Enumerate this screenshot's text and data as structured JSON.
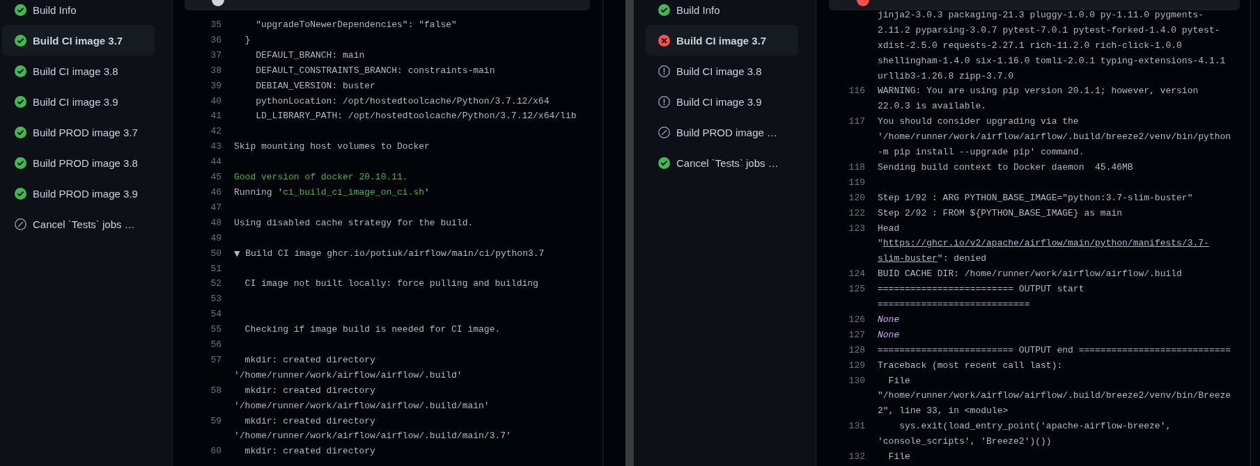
{
  "panes": [
    {
      "sidebar": {
        "items": [
          {
            "label": "Build Info",
            "kind": "success",
            "selected": false
          },
          {
            "label": "Build CI image 3.7",
            "kind": "success",
            "selected": true
          },
          {
            "label": "Build CI image 3.8",
            "kind": "success",
            "selected": false
          },
          {
            "label": "Build CI image 3.9",
            "kind": "success",
            "selected": false
          },
          {
            "label": "Build PROD image 3.7",
            "kind": "success",
            "selected": false
          },
          {
            "label": "Build PROD image 3.8",
            "kind": "success",
            "selected": false
          },
          {
            "label": "Build PROD image 3.9",
            "kind": "success",
            "selected": false
          },
          {
            "label": "Cancel `Tests` jobs …",
            "kind": "skipped",
            "selected": false
          }
        ]
      },
      "log": {
        "header": {
          "kind": "neutral"
        },
        "lines": [
          {
            "number": "35",
            "rows": [
              "    \"upgradeToNewerDependencies\": \"false\""
            ]
          },
          {
            "number": "36",
            "rows": [
              "  }"
            ]
          },
          {
            "number": "37",
            "rows": [
              "    DEFAULT_BRANCH: main"
            ]
          },
          {
            "number": "38",
            "rows": [
              "    DEFAULT_CONSTRAINTS_BRANCH: constraints-main"
            ]
          },
          {
            "number": "39",
            "rows": [
              "    DEBIAN_VERSION: buster"
            ]
          },
          {
            "number": "40",
            "rows": [
              "    pythonLocation: /opt/hostedtoolcache/Python/3.7.12/x64"
            ]
          },
          {
            "number": "41",
            "rows": [
              "    LD_LIBRARY_PATH: /opt/hostedtoolcache/Python/3.7.12/x64/lib"
            ]
          },
          {
            "number": "42"
          },
          {
            "number": "43",
            "rows": [
              "Skip mounting host volumes to Docker"
            ]
          },
          {
            "number": "44"
          },
          {
            "number": "45",
            "rows": [
              [
                {
                  "text": "Good version of docker 20.10.11.",
                  "kind": "green"
                }
              ]
            ]
          },
          {
            "number": "46",
            "rows": [
              [
                {
                  "text": "Running '"
                },
                {
                  "text": "ci_build_ci_image_on_ci.sh",
                  "kind": "green"
                },
                {
                  "text": "'"
                }
              ]
            ]
          },
          {
            "number": "47"
          },
          {
            "number": "48",
            "rows": [
              "Using disabled cache strategy for the build."
            ]
          },
          {
            "number": "49"
          },
          {
            "number": "50",
            "rows": [
              [
                {
                  "text": "▼",
                  "kind": "toggle"
                },
                {
                  "text": " Build CI image ghcr.io/potiuk/airflow/main/ci/python3.7"
                }
              ]
            ]
          },
          {
            "number": "51"
          },
          {
            "number": "52",
            "rows": [
              "  CI image not built locally: force pulling and building"
            ]
          },
          {
            "number": "53"
          },
          {
            "number": "54"
          },
          {
            "number": "55",
            "rows": [
              "  Checking if image build is needed for CI image."
            ]
          },
          {
            "number": "56"
          },
          {
            "number": "57",
            "rows": [
              "  mkdir: created directory",
              "'/home/runner/work/airflow/airflow/.build'"
            ]
          },
          {
            "number": "58",
            "rows": [
              "  mkdir: created directory",
              "'/home/runner/work/airflow/airflow/.build/main'"
            ]
          },
          {
            "number": "59",
            "rows": [
              "  mkdir: created directory",
              "'/home/runner/work/airflow/airflow/.build/main/3.7'"
            ]
          },
          {
            "number": "60",
            "rows": [
              "  mkdir: created directory"
            ]
          }
        ]
      }
    },
    {
      "sidebar": {
        "items": [
          {
            "label": "Build Info",
            "kind": "success",
            "selected": false
          },
          {
            "label": "Build CI image 3.7",
            "kind": "failure",
            "selected": true
          },
          {
            "label": "Build CI image 3.8",
            "kind": "cancelled",
            "selected": false
          },
          {
            "label": "Build CI image 3.9",
            "kind": "cancelled",
            "selected": false
          },
          {
            "label": "Build PROD image …",
            "kind": "skipped",
            "selected": false
          },
          {
            "label": "Cancel `Tests` jobs …",
            "kind": "success",
            "selected": false
          }
        ]
      },
      "log": {
        "header": {
          "kind": "failure"
        },
        "lines": [
          {
            "rows": [
              "jinja2-3.0.3 packaging-21.3 pluggy-1.0.0 py-1.11.0 pygments-",
              "2.11.2 pyparsing-3.0.7 pytest-7.0.1 pytest-forked-1.4.0 pytest-",
              "xdist-2.5.0 requests-2.27.1 rich-11.2.0 rich-click-1.0.0",
              "shellingham-1.4.0 six-1.16.0 tomli-2.0.1 typing-extensions-4.1.1",
              "urllib3-1.26.8 zipp-3.7.0"
            ]
          },
          {
            "number": "116",
            "rows": [
              "WARNING: You are using pip version 20.1.1; however, version",
              "22.0.3 is available."
            ]
          },
          {
            "number": "117",
            "rows": [
              "You should consider upgrading via the",
              "'/home/runner/work/airflow/airflow/.build/breeze2/venv/bin/python",
              "-m pip install --upgrade pip' command."
            ]
          },
          {
            "number": "118",
            "rows": [
              "Sending build context to Docker daemon  45.46MB"
            ]
          },
          {
            "number": "119"
          },
          {
            "number": "120",
            "rows": [
              "Step 1/92 : ARG PYTHON_BASE_IMAGE=\"python:3.7-slim-buster\""
            ]
          },
          {
            "number": "122",
            "rows": [
              "Step 2/92 : FROM ${PYTHON_BASE_IMAGE} as main"
            ]
          },
          {
            "number": "123",
            "rows": [
              "Head",
              [
                {
                  "text": "\""
                },
                {
                  "text": "https://ghcr.io/v2/apache/airflow/main/python/manifests/3.7-",
                  "kind": "link"
                }
              ],
              [
                {
                  "text": "slim-buster",
                  "kind": "link"
                },
                {
                  "text": "\": denied"
                }
              ]
            ]
          },
          {
            "number": "124",
            "rows": [
              "BUID CACHE DIR: /home/runner/work/airflow/airflow/.build"
            ]
          },
          {
            "number": "125",
            "rows": [
              "========================= OUTPUT start",
              "============================"
            ]
          },
          {
            "number": "126",
            "rows": [
              [
                {
                  "text": "None",
                  "kind": "constant"
                }
              ]
            ]
          },
          {
            "number": "127",
            "rows": [
              [
                {
                  "text": "None",
                  "kind": "constant"
                }
              ]
            ]
          },
          {
            "number": "128",
            "rows": [
              "========================= OUTPUT end ============================"
            ]
          },
          {
            "number": "129",
            "rows": [
              "Traceback (most recent call last):"
            ]
          },
          {
            "number": "130",
            "rows": [
              "  File",
              "\"/home/runner/work/airflow/airflow/.build/breeze2/venv/bin/Breeze",
              "2\", line 33, in <module>"
            ]
          },
          {
            "number": "131",
            "rows": [
              "    sys.exit(load_entry_point('apache-airflow-breeze',",
              "'console_scripts', 'Breeze2')())"
            ]
          },
          {
            "number": "132",
            "rows": [
              "  File"
            ]
          }
        ]
      }
    }
  ]
}
